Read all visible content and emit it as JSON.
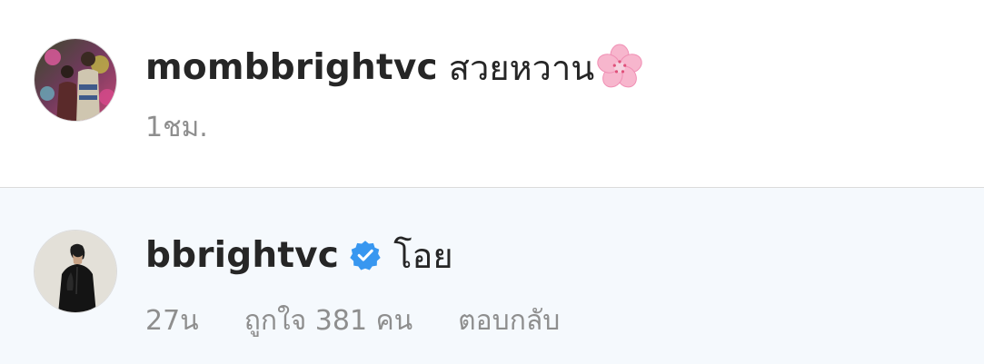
{
  "comments": [
    {
      "username": "mombbrightvc",
      "text": "สวยหวาน",
      "emoji_icon": "cherry-blossom-emoji",
      "time": "1ชม.",
      "avatar_icon": "profile-photo-two-people"
    },
    {
      "username": "bbrightvc",
      "verified": true,
      "text": "โอย",
      "time": "27น",
      "likes": "ถูกใจ 381 คน",
      "reply": "ตอบกลับ",
      "avatar_icon": "profile-photo-person"
    }
  ],
  "colors": {
    "text_primary": "#262626",
    "text_secondary": "#8e8e8e",
    "verified_blue": "#3897f0",
    "highlight_background": "#f5f9fd",
    "divider": "#dbdbdb"
  }
}
